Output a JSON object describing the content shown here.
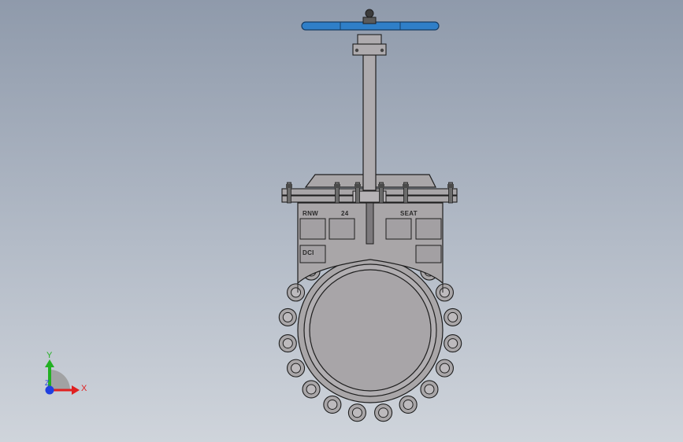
{
  "viewport": {
    "background_top": "#8f9aab",
    "background_bottom": "#cfd4db"
  },
  "valve": {
    "body_color": "#a9a6a8",
    "edge_color": "#1e1e1e",
    "handwheel_color": "#2f7fc8",
    "castings": {
      "left_top": "RNW",
      "center_top": "24",
      "right_top": "SEAT",
      "left_mid": "DCI"
    },
    "bolt_count": 20
  },
  "triad": {
    "x_label": "X",
    "y_label": "Y",
    "z_label": "Z",
    "x_color": "#e02020",
    "y_color": "#22b022",
    "z_color": "#2040e0"
  }
}
